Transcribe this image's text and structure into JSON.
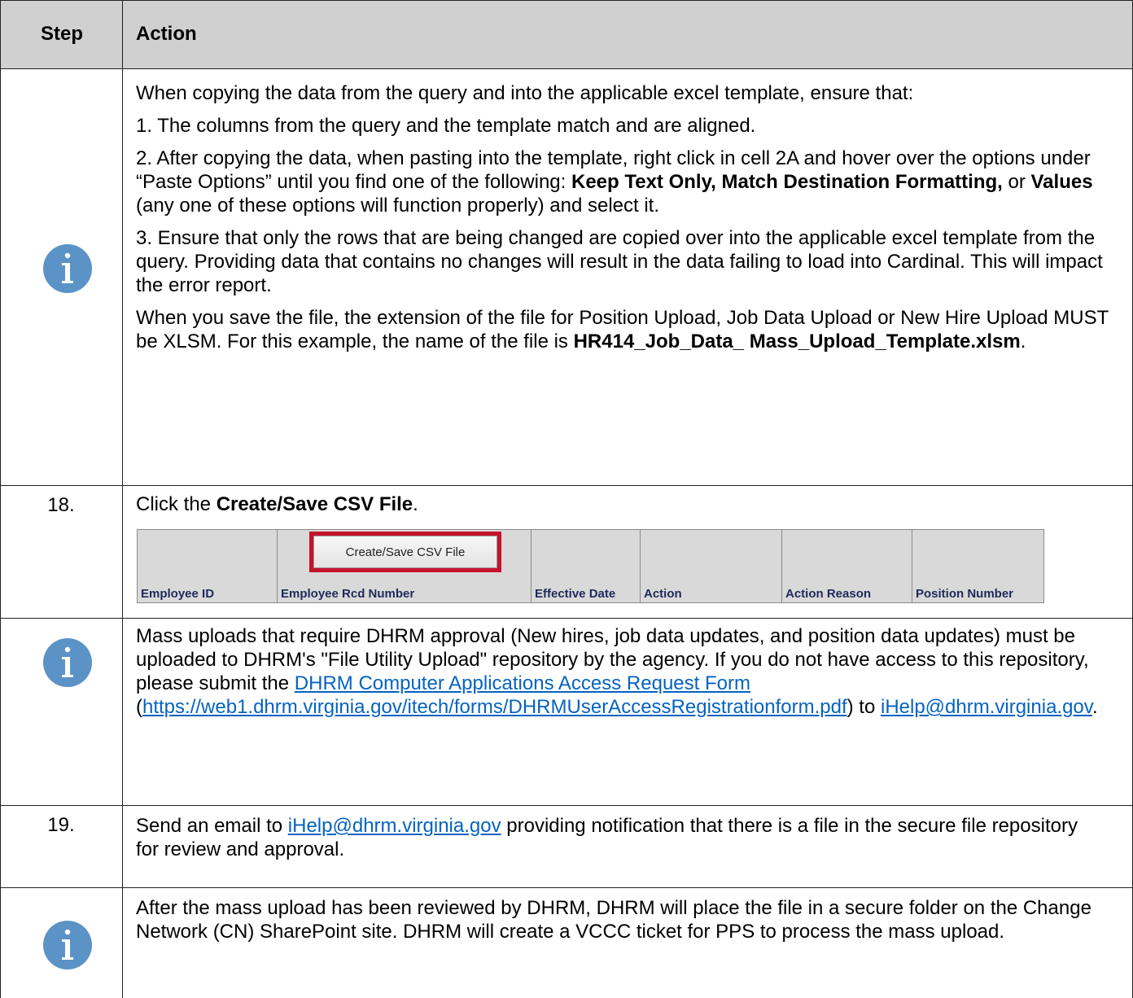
{
  "header": {
    "step": "Step",
    "action": "Action"
  },
  "rows": [
    {
      "paragraphs": [
        "When copying the data from the query and into the applicable excel template, ensure that:",
        "1.  The columns from the query and the template match and are aligned."
      ],
      "p3": {
        "before": "2.  After copying the data, when pasting into the template, right click in cell 2A and hover over the options under “Paste Options” until you find one of the following:  ",
        "bold1": "Keep Text Only, Match Destination Formatting,",
        "mid": " or ",
        "bold2": "Values",
        "after": " (any one of these options will function properly) and select it."
      },
      "p4": "3.  Ensure that only the rows that are being changed are copied over into the applicable excel template from the query.  Providing data that contains no changes will result in the data failing to load into Cardinal.  This will impact the error report.",
      "p5": {
        "before": "When you save the file, the extension of the file for Position Upload, Job Data Upload or New Hire Upload MUST be XLSM.  For this example, the name of the file is ",
        "bold": "HR414_Job_Data_ Mass_Upload_Template.xlsm",
        "after": "."
      }
    },
    {
      "step": "18.",
      "before": "Click the ",
      "bold": "Create/Save CSV File",
      "after": ".",
      "sheet": {
        "button": "Create/Save CSV File",
        "columns": [
          "Employee ID",
          "Employee Rcd Number",
          "Effective Date",
          "Action",
          "Action Reason",
          "Position Number"
        ]
      }
    },
    {
      "before": "Mass uploads that require DHRM approval (New hires, job data updates, and position data updates) must be uploaded to DHRM's \"File Utility Upload\" repository by the agency.  If you do not have access to this repository, please submit the ",
      "link1": "DHRM Computer Applications Access Request Form",
      "open": "(",
      "link2": "https://web1.dhrm.virginia.gov/itech/forms/DHRMUserAccessRegistrationform.pdf",
      "mid": ") to ",
      "link3": "iHelp@dhrm.virginia.gov",
      "after": "."
    },
    {
      "step": "19.",
      "before": "Send an email to ",
      "link": "iHelp@dhrm.virginia.gov",
      "after": " providing notification that there is a file in the secure file repository for review and approval."
    },
    {
      "text": "After the mass upload has been reviewed by DHRM, DHRM will place the file in a secure folder on the Change Network (CN) SharePoint site.  DHRM will create a VCCC ticket for PPS to process the mass upload."
    }
  ],
  "colors": {
    "header_bg": "#d0d0d0",
    "icon": "#5b93c7",
    "link": "#0563c1",
    "highlight": "#c4132a"
  },
  "icon_names": [
    "info-icon"
  ]
}
